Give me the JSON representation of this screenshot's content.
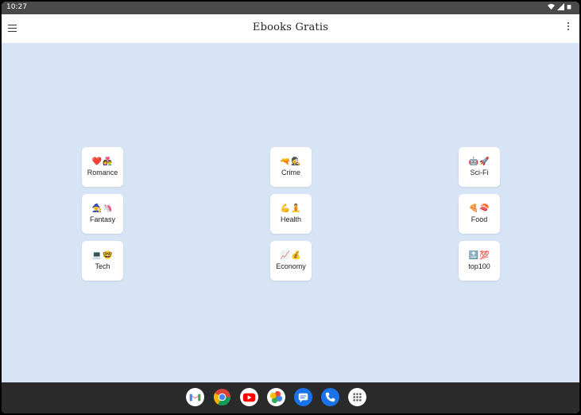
{
  "status_bar": {
    "time": "10:27",
    "icons": [
      "wifi-icon",
      "signal-icon",
      "battery-icon"
    ]
  },
  "app_bar": {
    "title": "Ebooks Gratis",
    "menu_icon": "hamburger-menu-icon",
    "overflow_icon": "more-vert-icon"
  },
  "categories": [
    {
      "id": "romance",
      "emoji": "❤️👩‍❤️‍👨",
      "label": "Romance"
    },
    {
      "id": "crime",
      "emoji": "🔫🕵️",
      "label": "Crime"
    },
    {
      "id": "scifi",
      "emoji": "🤖🚀",
      "label": "Sci-Fi"
    },
    {
      "id": "fantasy",
      "emoji": "🧙🦄",
      "label": "Fantasy"
    },
    {
      "id": "health",
      "emoji": "💪🧘",
      "label": "Health"
    },
    {
      "id": "food",
      "emoji": "🍕🍣",
      "label": "Food"
    },
    {
      "id": "tech",
      "emoji": "💻🤓",
      "label": "Tech"
    },
    {
      "id": "economy",
      "emoji": "📈💰",
      "label": "Economy"
    },
    {
      "id": "top100",
      "emoji": "🔝💯",
      "label": "top100"
    }
  ],
  "dock": [
    "gmail-icon",
    "chrome-icon",
    "youtube-icon",
    "photos-icon",
    "messages-icon",
    "phone-icon",
    "app-drawer-icon"
  ],
  "colors": {
    "background": "#d6e4f5",
    "app_bar": "#ffffff",
    "status_bar": "#4a4a4a",
    "nav_bar": "#2a2a2a",
    "card": "#ffffff"
  }
}
